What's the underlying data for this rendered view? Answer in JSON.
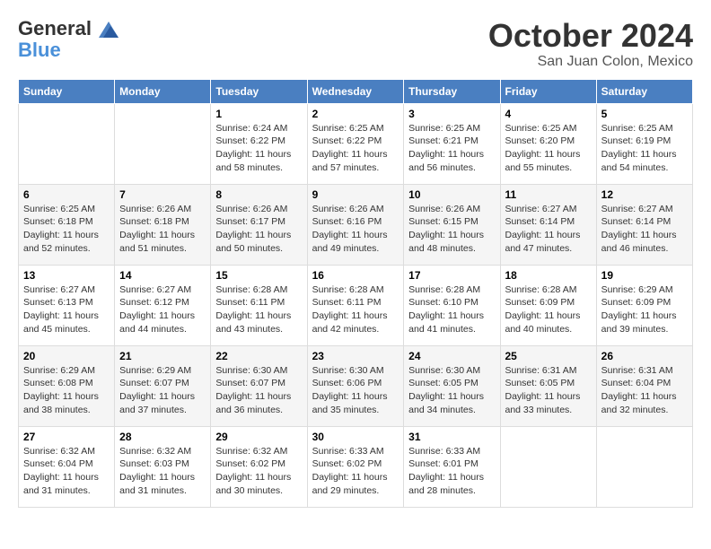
{
  "header": {
    "logo_general": "General",
    "logo_blue": "Blue",
    "month_title": "October 2024",
    "location": "San Juan Colon, Mexico"
  },
  "weekdays": [
    "Sunday",
    "Monday",
    "Tuesday",
    "Wednesday",
    "Thursday",
    "Friday",
    "Saturday"
  ],
  "weeks": [
    [
      {
        "day": "",
        "info": ""
      },
      {
        "day": "",
        "info": ""
      },
      {
        "day": "1",
        "info": "Sunrise: 6:24 AM\nSunset: 6:22 PM\nDaylight: 11 hours and 58 minutes."
      },
      {
        "day": "2",
        "info": "Sunrise: 6:25 AM\nSunset: 6:22 PM\nDaylight: 11 hours and 57 minutes."
      },
      {
        "day": "3",
        "info": "Sunrise: 6:25 AM\nSunset: 6:21 PM\nDaylight: 11 hours and 56 minutes."
      },
      {
        "day": "4",
        "info": "Sunrise: 6:25 AM\nSunset: 6:20 PM\nDaylight: 11 hours and 55 minutes."
      },
      {
        "day": "5",
        "info": "Sunrise: 6:25 AM\nSunset: 6:19 PM\nDaylight: 11 hours and 54 minutes."
      }
    ],
    [
      {
        "day": "6",
        "info": "Sunrise: 6:25 AM\nSunset: 6:18 PM\nDaylight: 11 hours and 52 minutes."
      },
      {
        "day": "7",
        "info": "Sunrise: 6:26 AM\nSunset: 6:18 PM\nDaylight: 11 hours and 51 minutes."
      },
      {
        "day": "8",
        "info": "Sunrise: 6:26 AM\nSunset: 6:17 PM\nDaylight: 11 hours and 50 minutes."
      },
      {
        "day": "9",
        "info": "Sunrise: 6:26 AM\nSunset: 6:16 PM\nDaylight: 11 hours and 49 minutes."
      },
      {
        "day": "10",
        "info": "Sunrise: 6:26 AM\nSunset: 6:15 PM\nDaylight: 11 hours and 48 minutes."
      },
      {
        "day": "11",
        "info": "Sunrise: 6:27 AM\nSunset: 6:14 PM\nDaylight: 11 hours and 47 minutes."
      },
      {
        "day": "12",
        "info": "Sunrise: 6:27 AM\nSunset: 6:14 PM\nDaylight: 11 hours and 46 minutes."
      }
    ],
    [
      {
        "day": "13",
        "info": "Sunrise: 6:27 AM\nSunset: 6:13 PM\nDaylight: 11 hours and 45 minutes."
      },
      {
        "day": "14",
        "info": "Sunrise: 6:27 AM\nSunset: 6:12 PM\nDaylight: 11 hours and 44 minutes."
      },
      {
        "day": "15",
        "info": "Sunrise: 6:28 AM\nSunset: 6:11 PM\nDaylight: 11 hours and 43 minutes."
      },
      {
        "day": "16",
        "info": "Sunrise: 6:28 AM\nSunset: 6:11 PM\nDaylight: 11 hours and 42 minutes."
      },
      {
        "day": "17",
        "info": "Sunrise: 6:28 AM\nSunset: 6:10 PM\nDaylight: 11 hours and 41 minutes."
      },
      {
        "day": "18",
        "info": "Sunrise: 6:28 AM\nSunset: 6:09 PM\nDaylight: 11 hours and 40 minutes."
      },
      {
        "day": "19",
        "info": "Sunrise: 6:29 AM\nSunset: 6:09 PM\nDaylight: 11 hours and 39 minutes."
      }
    ],
    [
      {
        "day": "20",
        "info": "Sunrise: 6:29 AM\nSunset: 6:08 PM\nDaylight: 11 hours and 38 minutes."
      },
      {
        "day": "21",
        "info": "Sunrise: 6:29 AM\nSunset: 6:07 PM\nDaylight: 11 hours and 37 minutes."
      },
      {
        "day": "22",
        "info": "Sunrise: 6:30 AM\nSunset: 6:07 PM\nDaylight: 11 hours and 36 minutes."
      },
      {
        "day": "23",
        "info": "Sunrise: 6:30 AM\nSunset: 6:06 PM\nDaylight: 11 hours and 35 minutes."
      },
      {
        "day": "24",
        "info": "Sunrise: 6:30 AM\nSunset: 6:05 PM\nDaylight: 11 hours and 34 minutes."
      },
      {
        "day": "25",
        "info": "Sunrise: 6:31 AM\nSunset: 6:05 PM\nDaylight: 11 hours and 33 minutes."
      },
      {
        "day": "26",
        "info": "Sunrise: 6:31 AM\nSunset: 6:04 PM\nDaylight: 11 hours and 32 minutes."
      }
    ],
    [
      {
        "day": "27",
        "info": "Sunrise: 6:32 AM\nSunset: 6:04 PM\nDaylight: 11 hours and 31 minutes."
      },
      {
        "day": "28",
        "info": "Sunrise: 6:32 AM\nSunset: 6:03 PM\nDaylight: 11 hours and 31 minutes."
      },
      {
        "day": "29",
        "info": "Sunrise: 6:32 AM\nSunset: 6:02 PM\nDaylight: 11 hours and 30 minutes."
      },
      {
        "day": "30",
        "info": "Sunrise: 6:33 AM\nSunset: 6:02 PM\nDaylight: 11 hours and 29 minutes."
      },
      {
        "day": "31",
        "info": "Sunrise: 6:33 AM\nSunset: 6:01 PM\nDaylight: 11 hours and 28 minutes."
      },
      {
        "day": "",
        "info": ""
      },
      {
        "day": "",
        "info": ""
      }
    ]
  ]
}
